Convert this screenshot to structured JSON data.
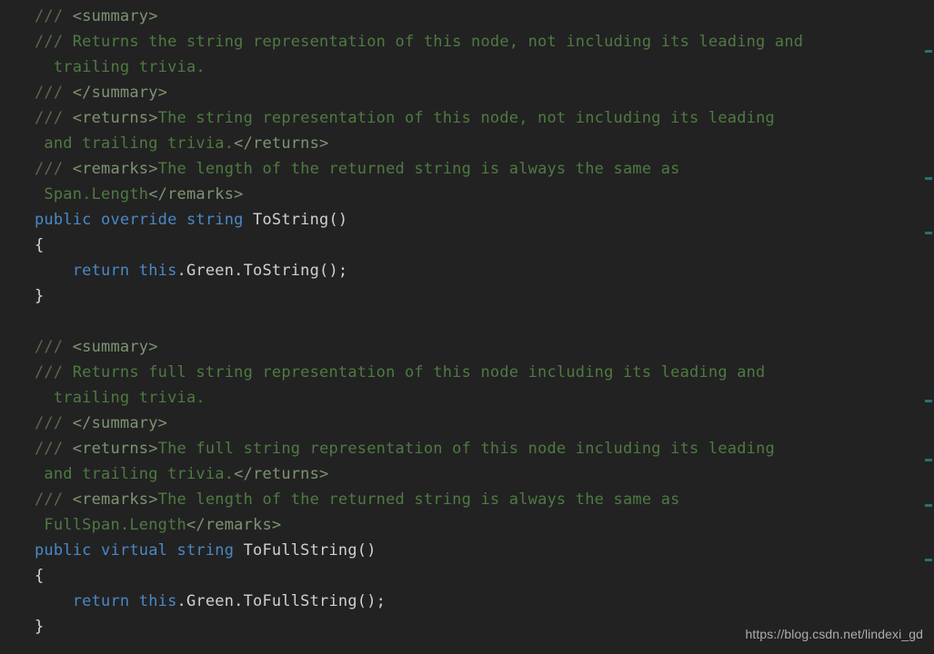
{
  "editor": {
    "background_color": "#222222",
    "language": "csharp",
    "watermark": "https://blog.csdn.net/lindexi_gd",
    "colors": {
      "comment_slashes": "#5a6a4a",
      "xml_doc_tag": "#7d9472",
      "xml_doc_text": "#4e7a42",
      "keyword": "#4a88c7",
      "identifier": "#d0d0d0",
      "brace": "#d6d6d6",
      "scroll_mark": "#2d7d82"
    }
  },
  "code": {
    "lines": [
      {
        "index": 0,
        "indent": 0,
        "segments": [
          {
            "kind": "slashes",
            "text": "/// "
          },
          {
            "kind": "xmltag",
            "text": "<summary>"
          }
        ]
      },
      {
        "index": 1,
        "indent": 0,
        "segments": [
          {
            "kind": "slashes",
            "text": "/// "
          },
          {
            "kind": "doctext",
            "text": "Returns the string representation of this node, not including its leading and"
          }
        ]
      },
      {
        "index": 2,
        "indent": 0,
        "segments": [
          {
            "kind": "doctext",
            "text": "  trailing trivia."
          }
        ]
      },
      {
        "index": 3,
        "indent": 0,
        "segments": [
          {
            "kind": "slashes",
            "text": "/// "
          },
          {
            "kind": "xmltag",
            "text": "</summary>"
          }
        ]
      },
      {
        "index": 4,
        "indent": 0,
        "segments": [
          {
            "kind": "slashes",
            "text": "/// "
          },
          {
            "kind": "xmltag",
            "text": "<returns>"
          },
          {
            "kind": "doctext",
            "text": "The string representation of this node, not including its leading"
          }
        ]
      },
      {
        "index": 5,
        "indent": 0,
        "segments": [
          {
            "kind": "doctext",
            "text": " and trailing trivia."
          },
          {
            "kind": "xmltag",
            "text": "</returns>"
          }
        ]
      },
      {
        "index": 6,
        "indent": 0,
        "segments": [
          {
            "kind": "slashes",
            "text": "/// "
          },
          {
            "kind": "xmltag",
            "text": "<remarks>"
          },
          {
            "kind": "doctext",
            "text": "The length of the returned string is always the same as"
          }
        ]
      },
      {
        "index": 7,
        "indent": 0,
        "segments": [
          {
            "kind": "doctext",
            "text": " Span.Length"
          },
          {
            "kind": "xmltag",
            "text": "</remarks>"
          }
        ]
      },
      {
        "index": 8,
        "indent": 0,
        "segments": [
          {
            "kind": "keyword",
            "text": "public override string"
          },
          {
            "kind": "ident",
            "text": " ToString()"
          }
        ]
      },
      {
        "index": 9,
        "indent": 0,
        "segments": [
          {
            "kind": "brace",
            "text": "{"
          }
        ]
      },
      {
        "index": 10,
        "indent": 0,
        "segments": [
          {
            "kind": "keyword",
            "text": "    return this"
          },
          {
            "kind": "ident",
            "text": ".Green.ToString();"
          }
        ]
      },
      {
        "index": 11,
        "indent": 0,
        "segments": [
          {
            "kind": "brace",
            "text": "}"
          }
        ]
      },
      {
        "index": 12,
        "indent": 0,
        "segments": [
          {
            "kind": "blank",
            "text": " "
          }
        ]
      },
      {
        "index": 13,
        "indent": 0,
        "segments": [
          {
            "kind": "slashes",
            "text": "/// "
          },
          {
            "kind": "xmltag",
            "text": "<summary>"
          }
        ]
      },
      {
        "index": 14,
        "indent": 0,
        "segments": [
          {
            "kind": "slashes",
            "text": "/// "
          },
          {
            "kind": "doctext",
            "text": "Returns full string representation of this node including its leading and"
          }
        ]
      },
      {
        "index": 15,
        "indent": 0,
        "segments": [
          {
            "kind": "doctext",
            "text": "  trailing trivia."
          }
        ]
      },
      {
        "index": 16,
        "indent": 0,
        "segments": [
          {
            "kind": "slashes",
            "text": "/// "
          },
          {
            "kind": "xmltag",
            "text": "</summary>"
          }
        ]
      },
      {
        "index": 17,
        "indent": 0,
        "segments": [
          {
            "kind": "slashes",
            "text": "/// "
          },
          {
            "kind": "xmltag",
            "text": "<returns>"
          },
          {
            "kind": "doctext",
            "text": "The full string representation of this node including its leading"
          }
        ]
      },
      {
        "index": 18,
        "indent": 0,
        "segments": [
          {
            "kind": "doctext",
            "text": " and trailing trivia."
          },
          {
            "kind": "xmltag",
            "text": "</returns>"
          }
        ]
      },
      {
        "index": 19,
        "indent": 0,
        "segments": [
          {
            "kind": "slashes",
            "text": "/// "
          },
          {
            "kind": "xmltag",
            "text": "<remarks>"
          },
          {
            "kind": "doctext",
            "text": "The length of the returned string is always the same as"
          }
        ]
      },
      {
        "index": 20,
        "indent": 0,
        "segments": [
          {
            "kind": "doctext",
            "text": " FullSpan.Length"
          },
          {
            "kind": "xmltag",
            "text": "</remarks>"
          }
        ]
      },
      {
        "index": 21,
        "indent": 0,
        "segments": [
          {
            "kind": "keyword",
            "text": "public virtual string"
          },
          {
            "kind": "ident",
            "text": " ToFullString()"
          }
        ]
      },
      {
        "index": 22,
        "indent": 0,
        "segments": [
          {
            "kind": "brace",
            "text": "{"
          }
        ]
      },
      {
        "index": 23,
        "indent": 0,
        "segments": [
          {
            "kind": "keyword",
            "text": "    return this"
          },
          {
            "kind": "ident",
            "text": ".Green.ToFullString();"
          }
        ]
      },
      {
        "index": 24,
        "indent": 0,
        "segments": [
          {
            "kind": "brace",
            "text": "}"
          }
        ]
      }
    ]
  },
  "scrollbar": {
    "marks": [
      55,
      195,
      255,
      440,
      505,
      555,
      615
    ]
  }
}
